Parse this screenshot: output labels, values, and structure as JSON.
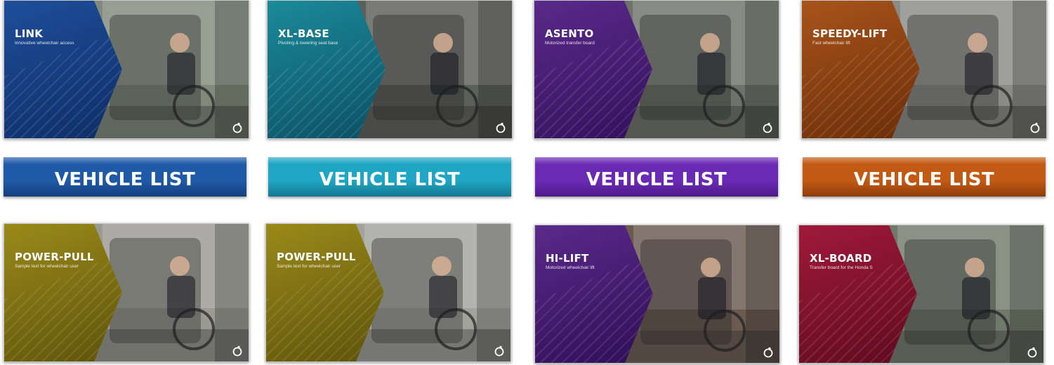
{
  "products": [
    {
      "title": "LINK",
      "subtitle": "Innovative wheelchair access",
      "color": "#1e4e9a",
      "dark": "#0e2d66",
      "scene": "#7f8a7a"
    },
    {
      "title": "XL-BASE",
      "subtitle": "Pivoting & lowering seat base",
      "color": "#1b8a9a",
      "dark": "#0b4f63",
      "scene": "#5d5f5a"
    },
    {
      "title": "ASENTO",
      "subtitle": "Motorized transfer board",
      "color": "#5a2a8a",
      "dark": "#33105c",
      "scene": "#6e7268"
    },
    {
      "title": "SPEEDY-LIFT",
      "subtitle": "Fast wheelchair lift",
      "color": "#a8541a",
      "dark": "#6a2d08",
      "scene": "#8a8a86"
    },
    {
      "title": "POWER-PULL",
      "subtitle": "Sample text for wheelchair user",
      "color": "#9a8a1a",
      "dark": "#5e520a",
      "scene": "#9a9a92"
    },
    {
      "title": "POWER-PULL",
      "subtitle": "Sample text for wheelchair user",
      "color": "#9a8a1a",
      "dark": "#5e520a",
      "scene": "#a2a49c"
    },
    {
      "title": "HI-LIFT",
      "subtitle": "Motorized wheelchair lift",
      "color": "#5a2a8a",
      "dark": "#2f0e56",
      "scene": "#6a5a50"
    },
    {
      "title": "XL-BOARD",
      "subtitle": "Transfer board for the Honda S",
      "color": "#a01a3a",
      "dark": "#5e0a1e",
      "scene": "#707a6a"
    }
  ],
  "vehicle_buttons": [
    {
      "label": "VEHICLE LIST",
      "color": "#1f5aa8",
      "dark": "#153f7c"
    },
    {
      "label": "VEHICLE LIST",
      "color": "#1fa6c4",
      "dark": "#147890"
    },
    {
      "label": "VEHICLE LIST",
      "color": "#6a2ab4",
      "dark": "#4c1a86"
    },
    {
      "label": "VEHICLE LIST",
      "color": "#c25a14",
      "dark": "#8e3e0a"
    }
  ],
  "icons": {
    "card_logo": "wheelchair-logo-icon"
  }
}
